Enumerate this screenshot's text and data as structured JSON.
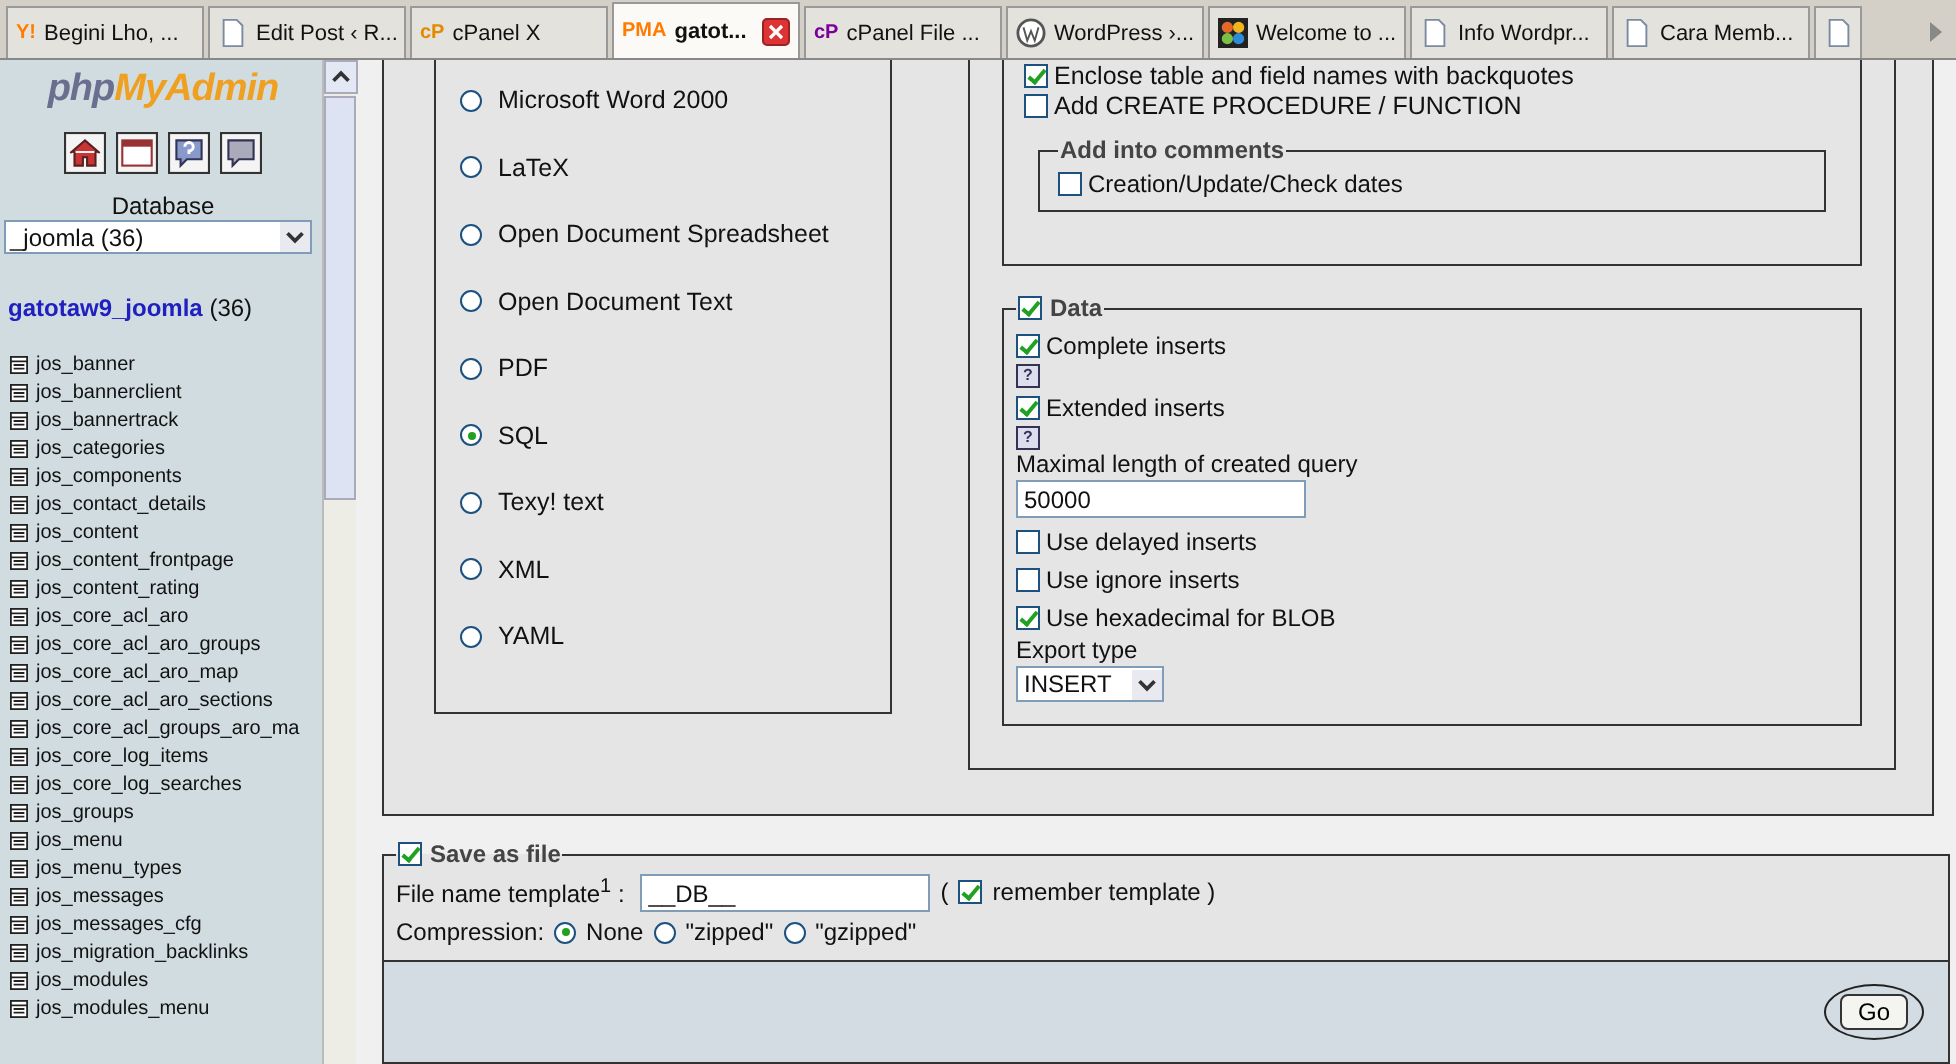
{
  "tabs": [
    {
      "label": "Begini Lho, ...",
      "selected": false,
      "kind": "badge",
      "badge": "Y!"
    },
    {
      "label": "Edit Post ‹ R...",
      "selected": false,
      "kind": "page"
    },
    {
      "label": "cPanel X",
      "selected": false,
      "kind": "badge",
      "badge": "cP"
    },
    {
      "label": "gatot...",
      "selected": true,
      "kind": "badge",
      "badge": "PMA"
    },
    {
      "label": "cPanel File ...",
      "selected": false,
      "kind": "badge",
      "badge": "cP"
    },
    {
      "label": "WordPress ›...",
      "selected": false,
      "kind": "circle"
    },
    {
      "label": "Welcome to ...",
      "selected": false,
      "kind": "grid"
    },
    {
      "label": "Info Wordpr...",
      "selected": false,
      "kind": "page"
    },
    {
      "label": "Cara Memb...",
      "selected": false,
      "kind": "page"
    },
    {
      "selected": false,
      "kind": "page"
    }
  ],
  "sidebar": {
    "logo_a": "php",
    "logo_b": "MyAdmin",
    "database_label": "Database",
    "database_select": "_joomla (36)",
    "db_name": "gatotaw9_joomla",
    "db_count": "(36)",
    "tables": [
      "jos_banner",
      "jos_bannerclient",
      "jos_bannertrack",
      "jos_categories",
      "jos_components",
      "jos_contact_details",
      "jos_content",
      "jos_content_frontpage",
      "jos_content_rating",
      "jos_core_acl_aro",
      "jos_core_acl_aro_groups",
      "jos_core_acl_aro_map",
      "jos_core_acl_aro_sections",
      "jos_core_acl_groups_aro_ma",
      "jos_core_log_items",
      "jos_core_log_searches",
      "jos_groups",
      "jos_menu",
      "jos_menu_types",
      "jos_messages",
      "jos_messages_cfg",
      "jos_migration_backlinks",
      "jos_modules",
      "jos_modules_menu"
    ]
  },
  "formats": [
    {
      "label": "Microsoft Word 2000",
      "selected": false
    },
    {
      "label": "LaTeX",
      "selected": false
    },
    {
      "label": "Open Document Spreadsheet",
      "selected": false
    },
    {
      "label": "Open Document Text",
      "selected": false
    },
    {
      "label": "PDF",
      "selected": false
    },
    {
      "label": "SQL",
      "selected": true
    },
    {
      "label": "Texy! text",
      "selected": false
    },
    {
      "label": "XML",
      "selected": false
    },
    {
      "label": "YAML",
      "selected": false
    }
  ],
  "structure": {
    "options": [
      {
        "label": "Enclose table and field names with backquotes",
        "checked": true
      },
      {
        "label": "Add CREATE PROCEDURE / FUNCTION",
        "checked": false
      }
    ],
    "comments": {
      "legend": "Add into comments",
      "options": [
        {
          "label": "Creation/Update/Check dates",
          "checked": false
        }
      ]
    }
  },
  "data": {
    "legend": "Data",
    "checked": true,
    "options": [
      {
        "kind": "checkbox",
        "label": "Complete inserts",
        "checked": true
      },
      {
        "kind": "help",
        "label": "?"
      },
      {
        "kind": "checkbox",
        "label": "Extended inserts",
        "checked": true
      },
      {
        "kind": "help",
        "label": "?"
      },
      {
        "kind": "input",
        "label": "Maximal length of created query",
        "value": "50000"
      },
      {
        "kind": "checkbox",
        "label": "Use delayed inserts",
        "checked": false
      },
      {
        "kind": "checkbox",
        "label": "Use ignore inserts",
        "checked": false
      },
      {
        "kind": "checkbox",
        "label": "Use hexadecimal for BLOB",
        "checked": true
      },
      {
        "kind": "select",
        "label": "Export type",
        "value": "INSERT"
      }
    ]
  },
  "save": {
    "legend": "Save as file",
    "checked": true,
    "template_label": "File name template$^{1}$ :",
    "template_value": "__DB__",
    "paren_open": "(",
    "remember_label": "remember template )",
    "remember_checked": true,
    "compression_label": "Compression:",
    "compression": [
      {
        "label": "None",
        "selected": true
      },
      {
        "label": "\"zipped\"",
        "selected": false
      },
      {
        "label": "\"gzipped\"",
        "selected": false
      }
    ]
  },
  "go_button": "Go"
}
